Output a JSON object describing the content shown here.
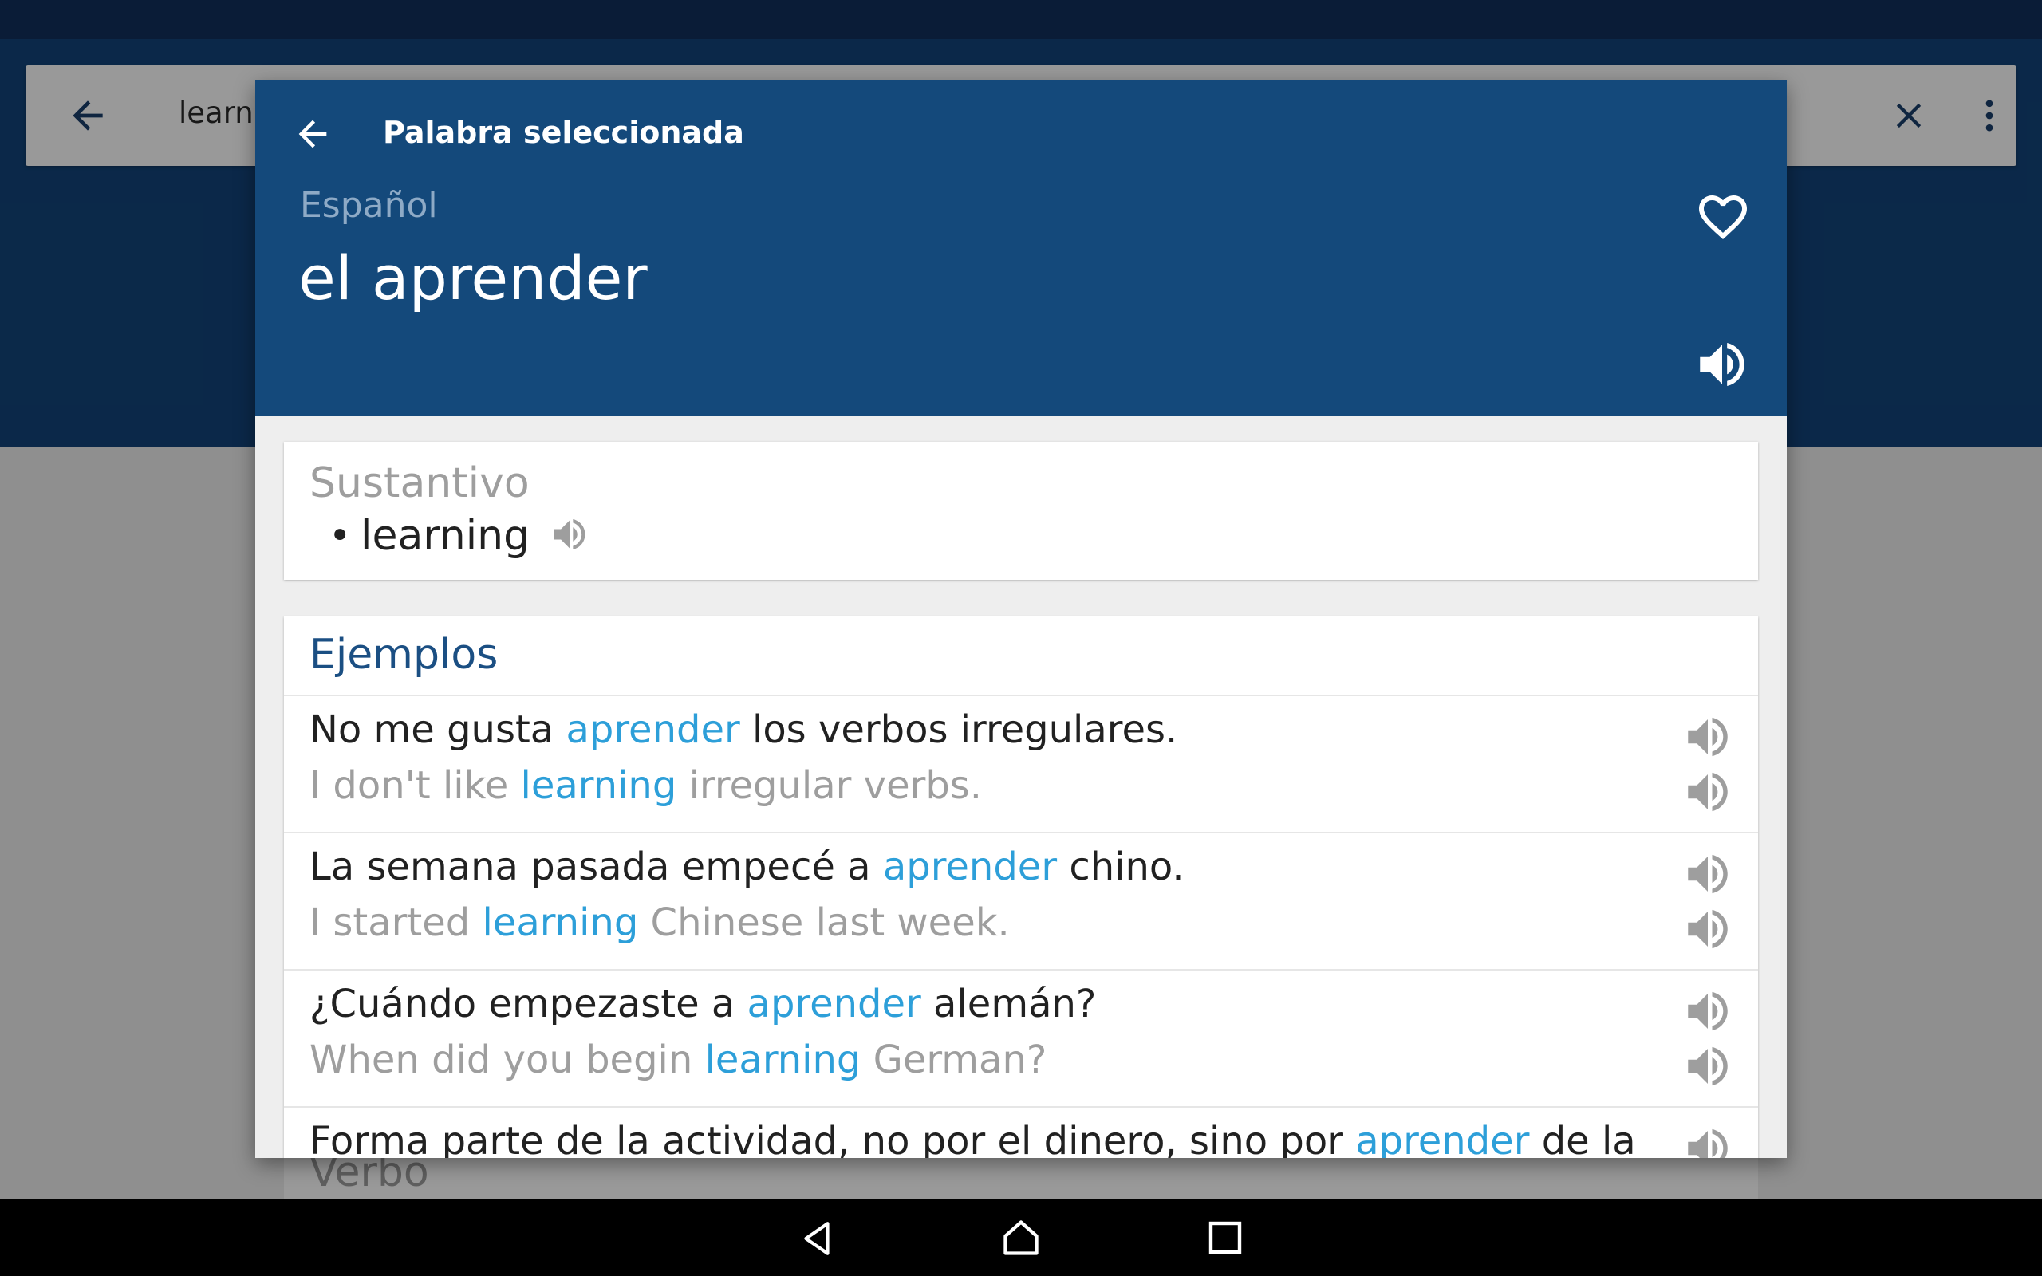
{
  "search": {
    "query": "learn",
    "icons": [
      "arrow-back-icon",
      "close-icon",
      "more-vert-icon"
    ]
  },
  "background": {
    "next_section_label": "Verbo"
  },
  "dialog": {
    "title": "Palabra seleccionada",
    "language": "Español",
    "word": "el aprender",
    "icons": [
      "arrow-back-icon",
      "heart-outline-icon",
      "speaker-icon"
    ],
    "noun_card": {
      "label": "Sustantivo",
      "bullet": "•",
      "translation": "learning"
    },
    "examples": {
      "title": "Ejemplos",
      "items": [
        {
          "es_pre": "No me gusta ",
          "es_hl": "aprender",
          "es_post": " los verbos irregulares.",
          "en_pre": "I don't like ",
          "en_hl": "learning",
          "en_post": " irregular verbs."
        },
        {
          "es_pre": "La semana pasada empecé a ",
          "es_hl": "aprender",
          "es_post": " chino.",
          "en_pre": "I started ",
          "en_hl": "learning",
          "en_post": " Chinese last week."
        },
        {
          "es_pre": "¿Cuándo empezaste a ",
          "es_hl": "aprender",
          "es_post": " alemán?",
          "en_pre": "When did you begin ",
          "en_hl": "learning",
          "en_post": " German?"
        },
        {
          "es_pre": "Forma parte de la actividad, no por el dinero, sino por ",
          "es_hl": "aprender",
          "es_post": " de la",
          "en_pre": "",
          "en_hl": "",
          "en_post": ""
        }
      ]
    }
  },
  "colors": {
    "status_bar": "#12305d",
    "app_bar": "#13447a",
    "dialog_header": "#14497b",
    "highlight": "#2d9fd9",
    "section_title": "#1b4f83"
  },
  "navbar": {
    "icons": [
      "nav-back-icon",
      "nav-home-icon",
      "nav-recents-icon"
    ]
  }
}
